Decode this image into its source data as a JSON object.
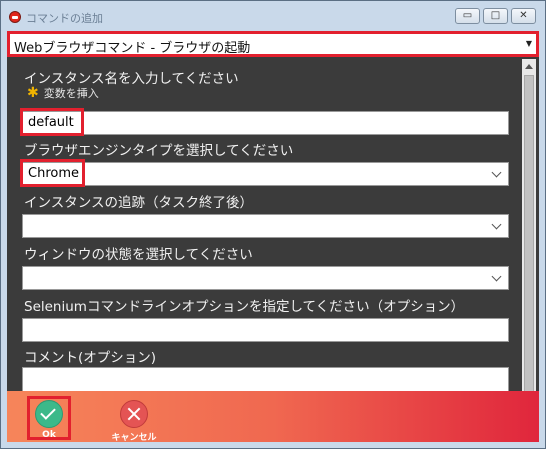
{
  "window": {
    "title": "コマンドの追加",
    "min_glyph": "▭",
    "max_glyph": "□",
    "close_glyph": "✕"
  },
  "command_select": {
    "value": "Webブラウザコマンド - ブラウザの起動",
    "arrow": "▼"
  },
  "form": {
    "instance_label": "インスタンス名を入力してください",
    "insert_variable": "変数を挿入",
    "instance_value": "default",
    "engine_label": "ブラウザエンジンタイプを選択してください",
    "engine_value": "Chrome",
    "tracking_label": "インスタンスの追跡（タスク終了後）",
    "tracking_value": "",
    "window_state_label": "ウィンドウの状態を選択してください",
    "window_state_value": "",
    "selenium_label": "Seleniumコマンドラインオプションを指定してください（オプション）",
    "selenium_value": "",
    "comment_label": "コメント(オプション)",
    "comment_value": ""
  },
  "footer": {
    "ok_label": "Ok",
    "cancel_label": "キャンセル"
  },
  "colors": {
    "highlight": "#e2202e",
    "panel_bg": "#3b3b3b",
    "ok": "#3cb98a",
    "cancel": "#e45454"
  }
}
